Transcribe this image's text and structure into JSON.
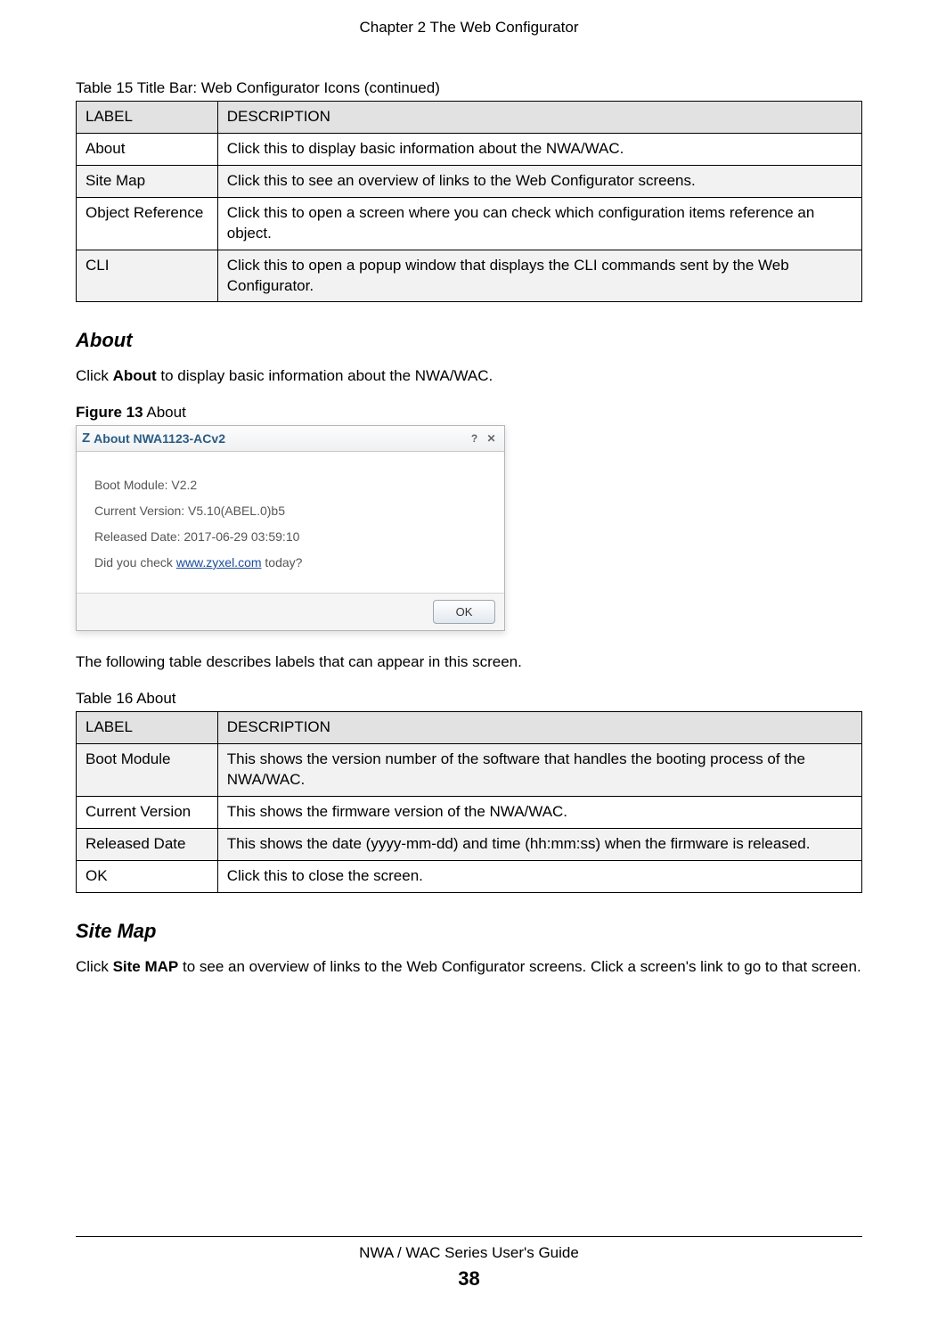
{
  "chapter_header": "Chapter 2 The Web Configurator",
  "table15": {
    "caption_prefix": "Table 15",
    "caption_rest": "   Title Bar: Web Configurator Icons (continued)",
    "headers": {
      "label": "LABEL",
      "description": "DESCRIPTION"
    },
    "rows": [
      {
        "label": "About",
        "description": "Click this to display basic information about the NWA/WAC."
      },
      {
        "label": "Site Map",
        "description": "Click this to see an overview of links to the Web Configurator screens."
      },
      {
        "label": "Object Reference",
        "description": "Click this to open a screen where you can check which configuration items reference an object."
      },
      {
        "label": "CLI",
        "description": "Click this to open a popup window that displays the CLI commands sent by the Web Configurator."
      }
    ]
  },
  "about_section": {
    "heading": "About",
    "text_before_bold": "Click ",
    "text_bold": "About",
    "text_after_bold": " to display basic information about the NWA/WAC."
  },
  "figure13": {
    "number": "Figure 13",
    "title": "   About",
    "dialog": {
      "title": "About NWA1123-ACv2",
      "boot_module": "Boot Module: V2.2",
      "current_version": "Current Version: V5.10(ABEL.0)b5",
      "released_date": "Released Date: 2017-06-29 03:59:10",
      "link_prefix": "Did you check ",
      "link_text": "www.zyxel.com",
      "link_suffix": " today?",
      "ok_label": "OK",
      "help_label": "?",
      "close_label": "✕"
    }
  },
  "after_figure_text": "The following table describes labels that can appear in this screen.",
  "table16": {
    "caption_prefix": "Table 16",
    "caption_rest": "   About",
    "headers": {
      "label": "LABEL",
      "description": "DESCRIPTION"
    },
    "rows": [
      {
        "label": "Boot Module",
        "description": "This shows the version number of the software that handles the booting process of the NWA/WAC."
      },
      {
        "label": "Current Version",
        "description": "This shows the firmware version of the NWA/WAC."
      },
      {
        "label": "Released Date",
        "description": "This shows the date (yyyy-mm-dd) and time (hh:mm:ss) when the firmware is released."
      },
      {
        "label": "OK",
        "description": "Click this to close the screen."
      }
    ]
  },
  "sitemap_section": {
    "heading": "Site Map",
    "text_before_bold": "Click ",
    "text_bold": "Site MAP",
    "text_after_bold": " to see an overview of links to the Web Configurator screens. Click a screen's link to go to that screen."
  },
  "footer": {
    "guide": "NWA / WAC Series User's Guide",
    "page": "38"
  }
}
